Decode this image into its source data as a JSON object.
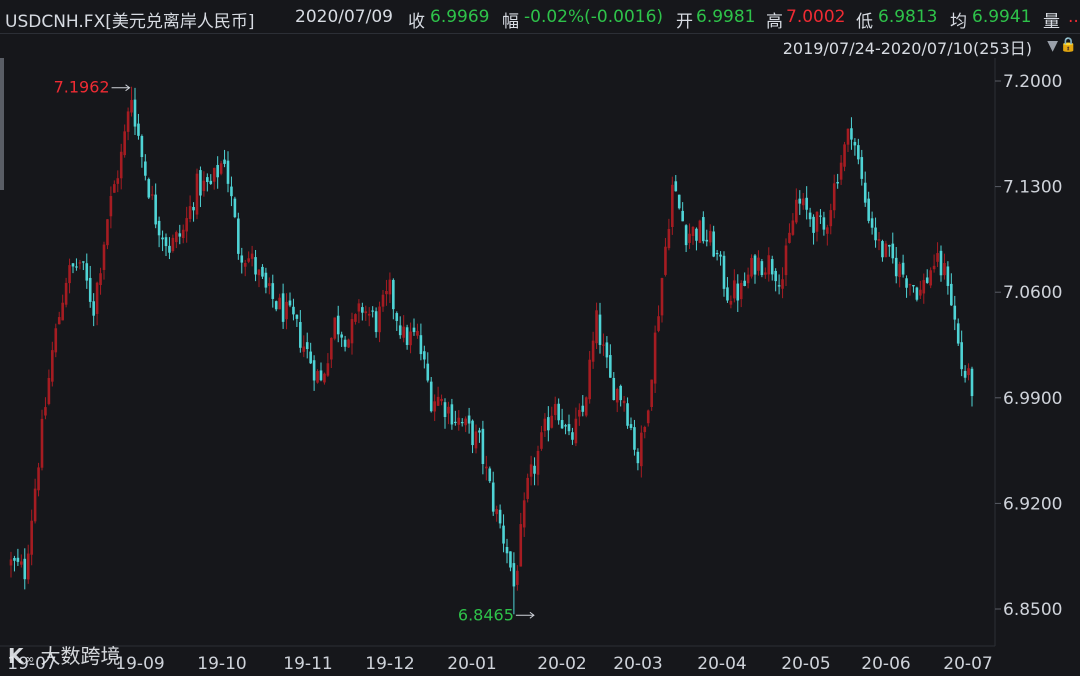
{
  "header": {
    "symbol": "USDCNH.FX[美元兑离岸人民币]",
    "date": "2020/07/09",
    "close_label": "收",
    "close_value": "6.9969",
    "change_label": "幅",
    "change_value": "-0.02%(-0.0016)",
    "open_label": "开",
    "open_value": "6.9981",
    "high_label": "高",
    "high_value": "7.0002",
    "low_label": "低",
    "low_value": "6.9813",
    "avg_label": "均",
    "avg_value": "6.9941",
    "volume_label": "量",
    "more": ".."
  },
  "range_label": "2019/07/24-2020/07/10(253日)",
  "icons": [
    "dropdown-triangle-icon",
    "lock-icon"
  ],
  "watermark": {
    "logo": "K",
    "text": "大数跨境"
  },
  "colors": {
    "background": "#16171b",
    "up": "#a61c22",
    "down": "#4fd4d6",
    "high_label": "#ee2b33",
    "low_label": "#2ec24a"
  },
  "chart_data": {
    "type": "candlestick",
    "y_ticks": [
      "7.2000",
      "7.1300",
      "7.0600",
      "6.9900",
      "6.9200",
      "6.8500"
    ],
    "ylim": [
      6.83,
      7.22
    ],
    "x_ticks": [
      "19-07",
      "19-09",
      "19-10",
      "19-11",
      "19-12",
      "20-01",
      "20-02",
      "20-03",
      "20-04",
      "20-05",
      "20-06",
      "20-07"
    ],
    "annotations": {
      "max_label": "7.1962",
      "min_label": "6.8465"
    },
    "close_path": [
      [
        0,
        6.88
      ],
      [
        4,
        6.875
      ],
      [
        8,
        6.95
      ],
      [
        12,
        7.02
      ],
      [
        16,
        7.07
      ],
      [
        20,
        7.08
      ],
      [
        24,
        7.05
      ],
      [
        28,
        7.11
      ],
      [
        32,
        7.15
      ],
      [
        35,
        7.19
      ],
      [
        38,
        7.15
      ],
      [
        42,
        7.11
      ],
      [
        46,
        7.09
      ],
      [
        50,
        7.1
      ],
      [
        54,
        7.13
      ],
      [
        58,
        7.13
      ],
      [
        62,
        7.15
      ],
      [
        66,
        7.09
      ],
      [
        70,
        7.08
      ],
      [
        74,
        7.06
      ],
      [
        78,
        7.05
      ],
      [
        82,
        7.04
      ],
      [
        86,
        7.02
      ],
      [
        90,
        7.0
      ],
      [
        94,
        7.04
      ],
      [
        98,
        7.03
      ],
      [
        102,
        7.05
      ],
      [
        106,
        7.04
      ],
      [
        110,
        7.06
      ],
      [
        114,
        7.03
      ],
      [
        118,
        7.03
      ],
      [
        122,
        6.99
      ],
      [
        124,
        6.99
      ],
      [
        128,
        6.98
      ],
      [
        132,
        6.97
      ],
      [
        136,
        6.96
      ],
      [
        140,
        6.92
      ],
      [
        144,
        6.89
      ],
      [
        146,
        6.865
      ],
      [
        150,
        6.93
      ],
      [
        154,
        6.96
      ],
      [
        158,
        6.99
      ],
      [
        162,
        6.96
      ],
      [
        166,
        6.98
      ],
      [
        170,
        7.04
      ],
      [
        174,
        7.0
      ],
      [
        178,
        6.99
      ],
      [
        182,
        6.95
      ],
      [
        184,
        6.97
      ],
      [
        188,
        7.05
      ],
      [
        192,
        7.13
      ],
      [
        196,
        7.1
      ],
      [
        200,
        7.1
      ],
      [
        204,
        7.09
      ],
      [
        208,
        7.06
      ],
      [
        212,
        7.06
      ],
      [
        216,
        7.08
      ],
      [
        220,
        7.08
      ],
      [
        224,
        7.07
      ],
      [
        228,
        7.12
      ],
      [
        232,
        7.11
      ],
      [
        236,
        7.1
      ],
      [
        240,
        7.14
      ],
      [
        244,
        7.17
      ],
      [
        248,
        7.12
      ],
      [
        252,
        7.09
      ],
      [
        256,
        7.08
      ],
      [
        260,
        7.07
      ],
      [
        264,
        7.06
      ],
      [
        268,
        7.08
      ],
      [
        272,
        7.07
      ],
      [
        276,
        7.01
      ],
      [
        279,
        6.997
      ]
    ]
  }
}
